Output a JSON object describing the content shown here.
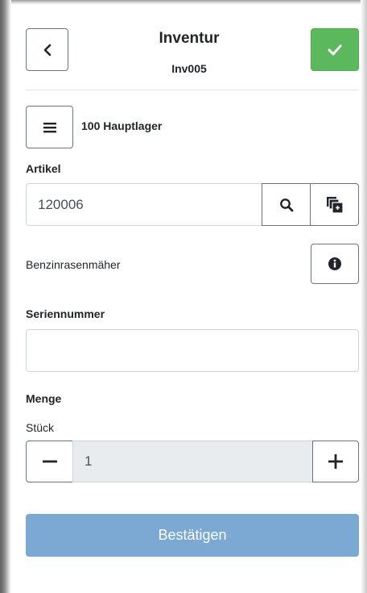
{
  "header": {
    "title": "Inventur",
    "subtitle": "Inv005"
  },
  "warehouse": {
    "label": "100 Hauptlager"
  },
  "article": {
    "label": "Artikel",
    "value": "120006",
    "description": "Benzinrasenmäher"
  },
  "serial": {
    "label": "Seriennummer",
    "value": ""
  },
  "quantity": {
    "label": "Menge",
    "unit": "Stück",
    "value": "1"
  },
  "footer": {
    "confirm_label": "Bestätigen"
  },
  "colors": {
    "success": "#5cb85c",
    "primary_disabled": "#7ba9d3",
    "input_disabled_bg": "#e9ecef"
  },
  "icons": [
    "chevron-left-icon",
    "check-icon",
    "menu-icon",
    "search-icon",
    "copy-add-icon",
    "info-icon",
    "minus-icon",
    "plus-icon"
  ]
}
